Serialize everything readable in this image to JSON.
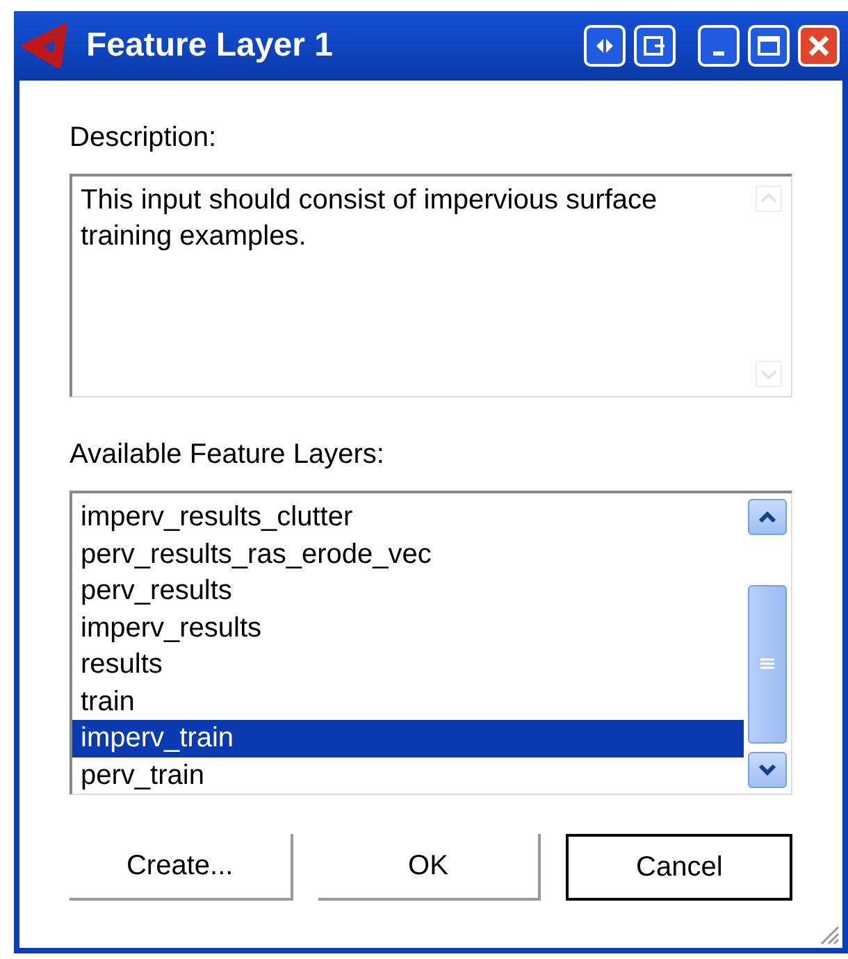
{
  "window": {
    "title": "Feature Layer 1"
  },
  "description": {
    "label": "Description:",
    "text": "This input should consist of impervious surface training examples."
  },
  "layers": {
    "label": "Available Feature Layers:",
    "items": [
      {
        "name": "imperv_results_clutter",
        "selected": false
      },
      {
        "name": "perv_results_ras_erode_vec",
        "selected": false
      },
      {
        "name": "perv_results",
        "selected": false
      },
      {
        "name": "imperv_results",
        "selected": false
      },
      {
        "name": "results",
        "selected": false
      },
      {
        "name": "train",
        "selected": false
      },
      {
        "name": "imperv_train",
        "selected": true
      },
      {
        "name": "perv_train",
        "selected": false
      }
    ]
  },
  "buttons": [
    {
      "label": "Create...",
      "default": false
    },
    {
      "label": "OK",
      "default": false
    },
    {
      "label": "Cancel",
      "default": true
    }
  ]
}
